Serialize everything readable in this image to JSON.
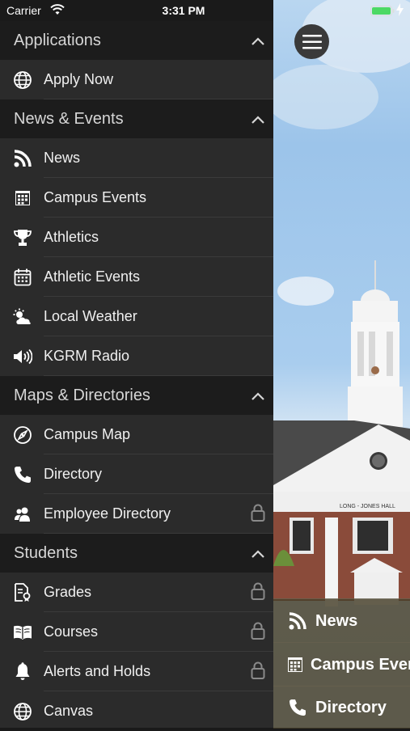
{
  "status": {
    "carrier": "Carrier",
    "time": "3:31 PM"
  },
  "sections": [
    {
      "title": "Applications",
      "items": [
        {
          "label": "Apply Now",
          "icon": "globe-icon",
          "locked": false
        }
      ]
    },
    {
      "title": "News & Events",
      "items": [
        {
          "label": "News",
          "icon": "rss-icon",
          "locked": false
        },
        {
          "label": "Campus Events",
          "icon": "calendar-grid-icon",
          "locked": false
        },
        {
          "label": "Athletics",
          "icon": "trophy-icon",
          "locked": false
        },
        {
          "label": "Athletic Events",
          "icon": "calendar-icon",
          "locked": false
        },
        {
          "label": "Local Weather",
          "icon": "weather-icon",
          "locked": false
        },
        {
          "label": "KGRM Radio",
          "icon": "speaker-icon",
          "locked": false
        }
      ]
    },
    {
      "title": "Maps & Directories",
      "items": [
        {
          "label": "Campus Map",
          "icon": "compass-icon",
          "locked": false
        },
        {
          "label": "Directory",
          "icon": "phone-icon",
          "locked": false
        },
        {
          "label": "Employee Directory",
          "icon": "people-icon",
          "locked": true
        }
      ]
    },
    {
      "title": "Students",
      "items": [
        {
          "label": "Grades",
          "icon": "grades-icon",
          "locked": true
        },
        {
          "label": "Courses",
          "icon": "book-icon",
          "locked": true
        },
        {
          "label": "Alerts and Holds",
          "icon": "bell-icon",
          "locked": true
        },
        {
          "label": "Canvas",
          "icon": "globe-icon",
          "locked": false
        }
      ]
    }
  ],
  "background": {
    "building_sign": "LONG - JONES HALL"
  },
  "quick_links": [
    {
      "label": "News",
      "icon": "rss-icon"
    },
    {
      "label": "Campus Events",
      "icon": "calendar-grid-icon"
    },
    {
      "label": "Directory",
      "icon": "phone-icon"
    }
  ]
}
